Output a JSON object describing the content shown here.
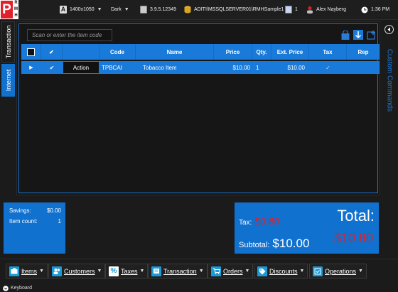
{
  "logo": {
    "big_letter": "P",
    "small_letters": [
      "R",
      "M",
      "H"
    ]
  },
  "topbar": {
    "resolution": "1400x1050",
    "theme": "Dark",
    "version": "3.9.5.12349",
    "database": "ADITI\\MSSQLSERVER01\\RMHSample1",
    "register_count": "1",
    "user": "Alex Nayberg",
    "time": "1:36 PM"
  },
  "left_tabs": {
    "transaction": "Transaction",
    "internet": "Internet"
  },
  "search": {
    "placeholder": "Scan or enter the item code"
  },
  "table": {
    "headers": {
      "code": "Code",
      "name": "Name",
      "price": "Price",
      "qty": "Qty.",
      "ext_price": "Ext. Price",
      "tax": "Tax",
      "rep": "Rep"
    },
    "rows": [
      {
        "action": "Action",
        "code": "TPBCAI",
        "name": "Tobacco Item",
        "price": "$10.00",
        "qty": "1",
        "ext_price": "$10.00",
        "tax": "✓",
        "rep": ""
      }
    ]
  },
  "right_panel": {
    "title": "Custom Commands"
  },
  "summary": {
    "savings_label": "Savings:",
    "savings_value": "$0.00",
    "item_count_label": "Item count:",
    "item_count_value": "1",
    "tax_label": "Tax:",
    "tax_value": "$0.80",
    "subtotal_label": "Subtotal:",
    "subtotal_value": "$10.00",
    "total_label": "Total:",
    "total_value": "$10.80"
  },
  "bottom_buttons": [
    {
      "label": "Items"
    },
    {
      "label": "Customers"
    },
    {
      "label": "Taxes"
    },
    {
      "label": "Transaction"
    },
    {
      "label": "Orders"
    },
    {
      "label": "Discounts"
    },
    {
      "label": "Operations"
    }
  ],
  "keyboard": {
    "label": "Keyboard"
  },
  "colors": {
    "accent": "#1a7ad9",
    "summary_blue": "#1171cf",
    "price_red": "#e0202a",
    "brand_red": "#e0202a"
  }
}
